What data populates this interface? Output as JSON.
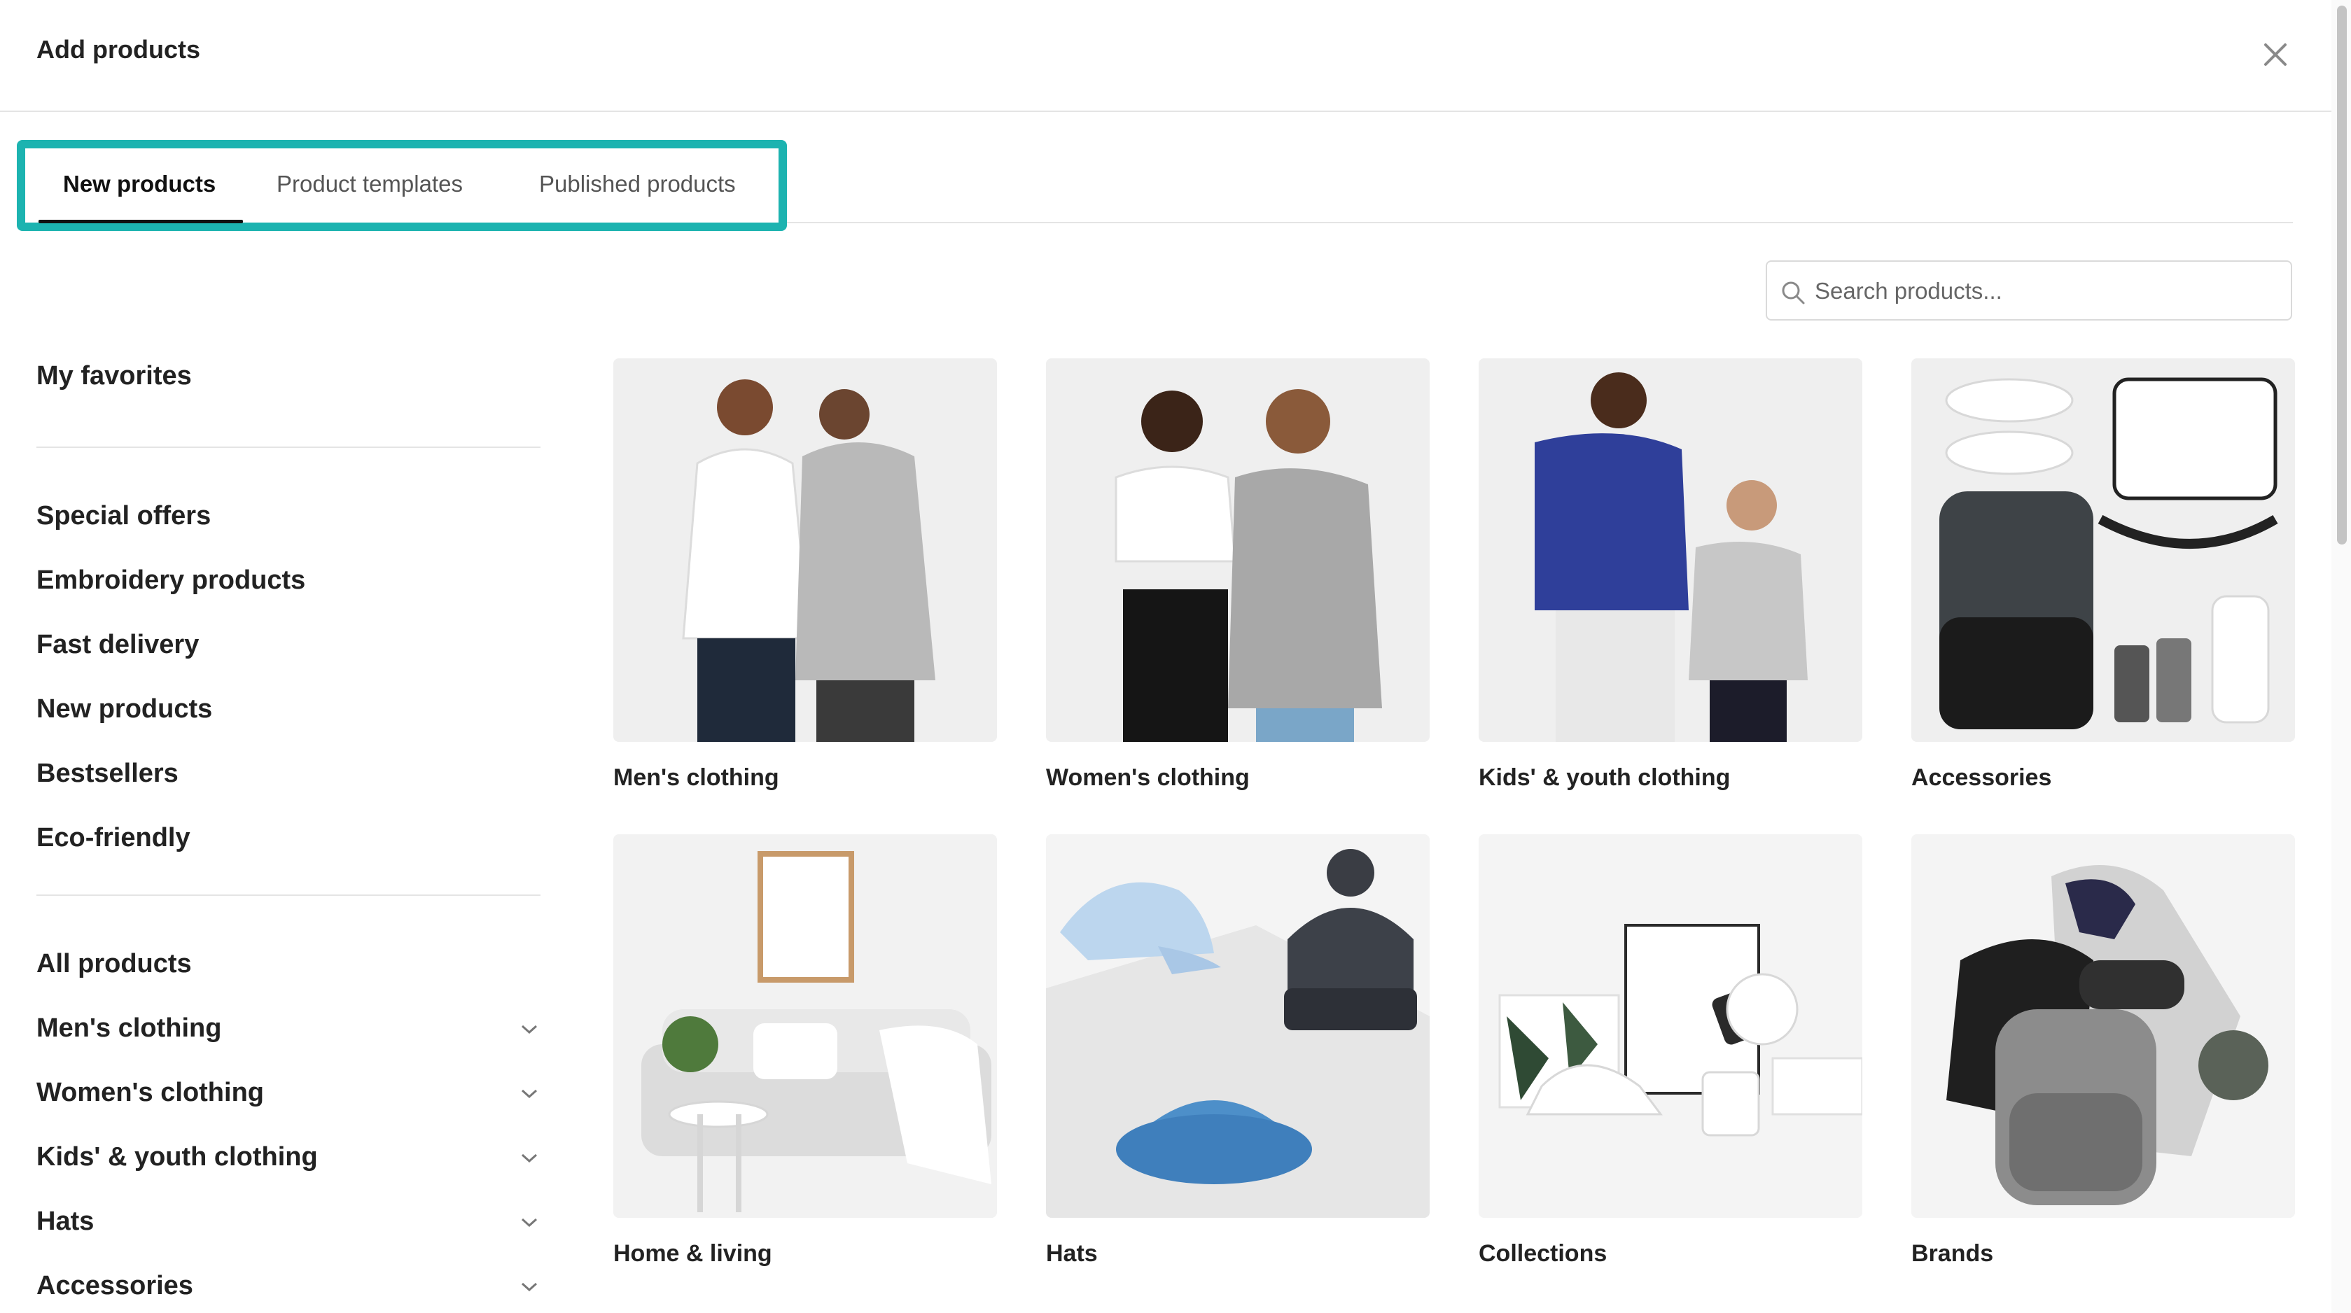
{
  "dialog": {
    "title": "Add products"
  },
  "tabs": [
    {
      "label": "New products",
      "active": true
    },
    {
      "label": "Product templates",
      "active": false
    },
    {
      "label": "Published products",
      "active": false
    }
  ],
  "search": {
    "placeholder": "Search products..."
  },
  "sidebar": {
    "favorites": "My favorites",
    "groups": [
      "Special offers",
      "Embroidery products",
      "Fast delivery",
      "New products",
      "Bestsellers",
      "Eco-friendly"
    ],
    "categories": [
      "All products",
      "Men's clothing",
      "Women's clothing",
      "Kids' & youth clothing",
      "Hats",
      "Accessories"
    ]
  },
  "cards": [
    {
      "label": "Men's clothing",
      "image": "mens-clothing-image"
    },
    {
      "label": "Women's clothing",
      "image": "womens-clothing-image"
    },
    {
      "label": "Kids' & youth clothing",
      "image": "kids-clothing-image"
    },
    {
      "label": "Accessories",
      "image": "accessories-image"
    },
    {
      "label": "Home & living",
      "image": "home-living-image"
    },
    {
      "label": "Hats",
      "image": "hats-image"
    },
    {
      "label": "Collections",
      "image": "collections-image"
    },
    {
      "label": "Brands",
      "image": "brands-image"
    }
  ],
  "colors": {
    "highlight": "#1cb3b0",
    "text": "#222222",
    "divider": "#e4e4e4"
  }
}
